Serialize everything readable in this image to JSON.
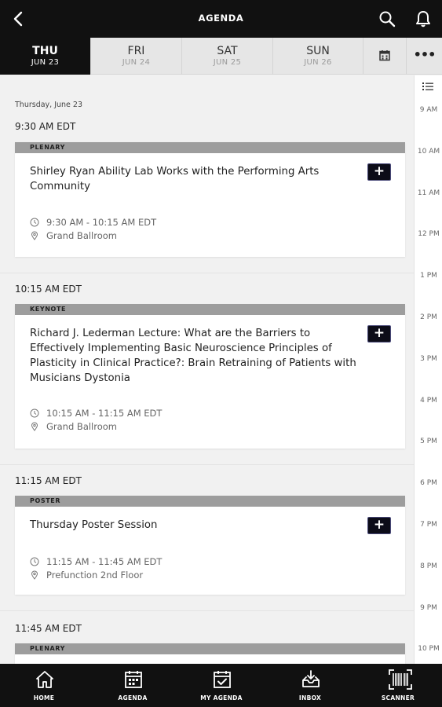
{
  "header": {
    "title": "AGENDA"
  },
  "days": [
    {
      "name": "THU",
      "date": "JUN 23"
    },
    {
      "name": "FRI",
      "date": "JUN 24"
    },
    {
      "name": "SAT",
      "date": "JUN 25"
    },
    {
      "name": "SUN",
      "date": "JUN 26"
    }
  ],
  "more_label": "•••",
  "date_label": "Thursday, June 23",
  "groups": [
    {
      "time": "9:30 AM EDT",
      "session": {
        "tag": "PLENARY",
        "title": "Shirley Ryan Ability Lab Works with the Performing Arts Community",
        "when": "9:30 AM - 10:15 AM EDT",
        "where": "Grand Ballroom",
        "add": "+"
      }
    },
    {
      "time": "10:15 AM EDT",
      "session": {
        "tag": "KEYNOTE",
        "title": "Richard J. Lederman Lecture: What are the Barriers to Effectively Implementing Basic Neuroscience Principles of Plasticity in Clinical Practice?: Brain Retraining of Patients with Musicians Dystonia",
        "when": "10:15 AM - 11:15 AM EDT",
        "where": "Grand Ballroom",
        "add": "+"
      }
    },
    {
      "time": "11:15 AM EDT",
      "session": {
        "tag": "POSTER",
        "title": "Thursday Poster Session",
        "when": "11:15 AM - 11:45 AM EDT",
        "where": "Prefunction 2nd Floor",
        "add": "+"
      }
    },
    {
      "time": "11:45 AM EDT",
      "session": {
        "tag": "PLENARY"
      }
    }
  ],
  "hours": [
    "9 AM",
    "10 AM",
    "11 AM",
    "12 PM",
    "1 PM",
    "2 PM",
    "3 PM",
    "4 PM",
    "5 PM",
    "6 PM",
    "7 PM",
    "8 PM",
    "9 PM",
    "10 PM"
  ],
  "nav": [
    {
      "label": "HOME",
      "icon": "home-icon"
    },
    {
      "label": "AGENDA",
      "icon": "calendar-icon"
    },
    {
      "label": "MY AGENDA",
      "icon": "calendar-check-icon"
    },
    {
      "label": "INBOX",
      "icon": "inbox-icon"
    },
    {
      "label": "SCANNER",
      "icon": "barcode-scanner-icon"
    }
  ],
  "colors": {
    "header_bg": "#111111",
    "tag_bg": "#9d9d9d",
    "add_button_bg": "#0c0c18",
    "active_tab_bg": "#111111"
  }
}
